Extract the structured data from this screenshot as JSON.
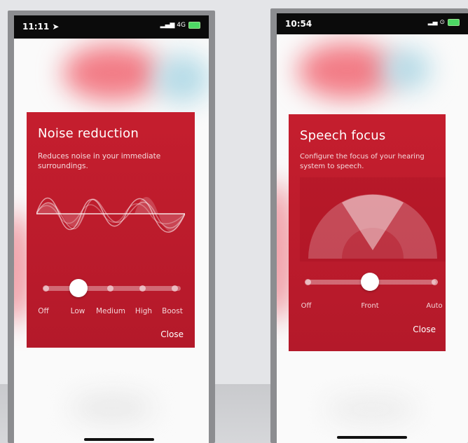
{
  "phone_left": {
    "status": {
      "time": "11:11 ➤",
      "network": "▂▄▆ 4G"
    },
    "panel": {
      "title": "Noise reduction",
      "description": "Reduces noise in your immediate surroundings.",
      "slider": {
        "stops": [
          "Off",
          "Low",
          "Medium",
          "High",
          "Boost"
        ],
        "selected": "Low",
        "selected_index": 1
      },
      "close_label": "Close"
    }
  },
  "phone_right": {
    "status": {
      "time": "10:54",
      "network": "▂▄ ⊙"
    },
    "panel": {
      "title": "Speech focus",
      "description": "Configure the focus of your hearing system to speech.",
      "slider": {
        "stops": [
          "Off",
          "Front",
          "Auto"
        ],
        "selected": "Front",
        "selected_index": 1
      },
      "close_label": "Close"
    }
  },
  "colors": {
    "panel_red": "#c51e2e",
    "status_bar": "#0b0b0b",
    "battery": "#4cd964"
  }
}
